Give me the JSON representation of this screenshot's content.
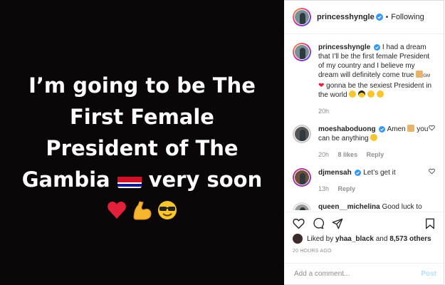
{
  "post_image": {
    "lines": [
      "I’m going to be The",
      "First Female",
      "President of The",
      "Gambia",
      "very soon"
    ],
    "emojis": [
      "heart-emoji",
      "flexed-biceps-emoji",
      "sunglasses-emoji"
    ]
  },
  "header": {
    "username": "princesshyngle",
    "separator": "•",
    "follow_status": "Following"
  },
  "caption": {
    "username": "princesshyngle",
    "text_1": "I had a dream that I’ll be the first female President of my country and I believe my dream will definitely come true",
    "text_2": "GM",
    "text_3": "gonna be the sexiest President in the world",
    "time": "20h"
  },
  "comments": [
    {
      "username": "moeshaboduong",
      "text": "Amen",
      "text_2": "you can be anything",
      "time": "20h",
      "likes": "8 likes",
      "reply": "Reply"
    },
    {
      "username": "djmensah",
      "text": "Let’s get it",
      "time": "13h",
      "reply": "Reply"
    },
    {
      "username": "queen__michelina",
      "text": "Good luck to you one thing I know for sure"
    }
  ],
  "likes": {
    "prefix": "Liked by",
    "user": "yhaa_black",
    "and": "and",
    "count": "8,573 others"
  },
  "timestamp": "20 HOURS AGO",
  "add_comment": {
    "placeholder": "Add a comment...",
    "post_label": "Post"
  },
  "colors": {
    "verified": "#3897f0",
    "heart": "#ed4956",
    "post_disabled": "#b2dffc",
    "image_bg": "#0b0608"
  }
}
